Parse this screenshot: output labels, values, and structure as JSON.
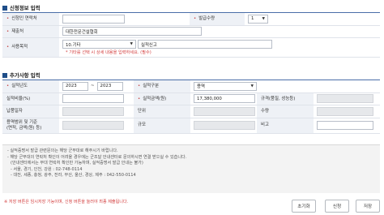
{
  "section1": {
    "title": "신청정보 입력",
    "applicant_contact": {
      "label": "신청인 연락처",
      "value": ""
    },
    "copies": {
      "label": "발급수량",
      "value": "1"
    },
    "submit_to": {
      "label": "제출처",
      "value": "대한전문건설협회"
    },
    "purpose": {
      "label": "사용목적",
      "select_value": "10.기타",
      "text_value": "실적신고",
      "hint": "* 기타를 선택 시 상세 내용을 입력하세요. (필수)"
    }
  },
  "section2": {
    "title": "추가사항 입력",
    "year": {
      "label": "실적년도",
      "from": "2023",
      "sep": "~",
      "to": "2023"
    },
    "category": {
      "label": "실적구분",
      "value": "용역"
    },
    "rate": {
      "label": "실적비율(%)",
      "value": ""
    },
    "amount": {
      "label": "실적금액(원)",
      "value": "17,380,000"
    },
    "spec": {
      "label": "규격(품질, 성능등)",
      "value": ""
    },
    "delivery_date": {
      "label": "납품일자",
      "value": ""
    },
    "unit": {
      "label": "단위",
      "value": ""
    },
    "quantity": {
      "label": "수량",
      "value": ""
    },
    "scope": {
      "label": "용역범위 및 기준\n(면적, 금액(원) 등)",
      "value": ""
    },
    "scale": {
      "label": "규모",
      "value": ""
    },
    "remark": {
      "label": "비고",
      "value": ""
    }
  },
  "notice": {
    "lines": [
      "- 실적증명서 발급 관련문의는 해당 군부대로 해주시기 바랍니다.",
      "- 해당 군부대의 연락처 확인이 어려울 경우에는 군조달 안내센터로 문의하시면 연결 받으실 수 있습니다.",
      "  (안내센터에서는 부대 연락처 확인만 가능하며, 실적증명서 발급 안내는 불가)",
      "  - 서울, 경기, 인천, 강원 : 02-748-0114",
      "  - 대전, 세종, 충청, 광주, 전라, 부산, 울산, 경상, 제주 : 042-550-0114"
    ],
    "warning": "※ 저장 버튼은 임시저장 기능이며, 신청 버튼을 눌러야 최종 제출됩니다."
  },
  "buttons": {
    "reset": "초기화",
    "apply": "신청",
    "save": "저장"
  }
}
